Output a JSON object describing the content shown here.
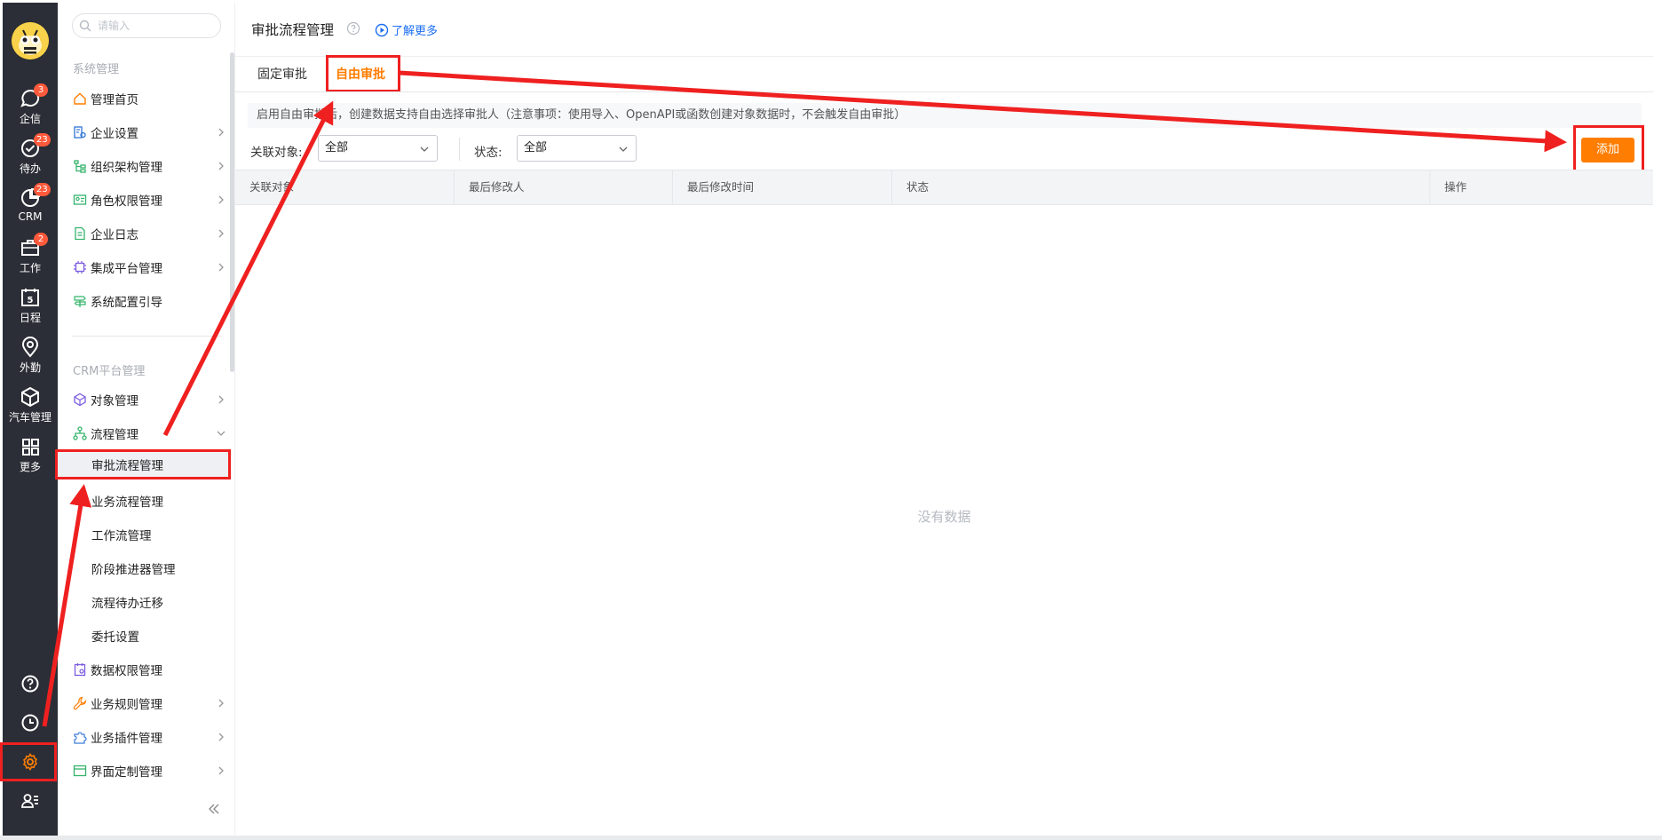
{
  "rail": {
    "items": [
      {
        "label": "企信",
        "icon": "chat-bubble-icon",
        "badge": "3"
      },
      {
        "label": "待办",
        "icon": "check-circle-icon",
        "badge": "23"
      },
      {
        "label": "CRM",
        "icon": "pie-chart-icon",
        "badge": "23"
      },
      {
        "label": "工作",
        "icon": "briefcase-icon",
        "badge": "2"
      },
      {
        "label": "日程",
        "icon": "calendar-icon",
        "badge": ""
      },
      {
        "label": "外勤",
        "icon": "location-pin-icon",
        "badge": ""
      },
      {
        "label": "汽车管理",
        "icon": "cube-icon",
        "badge": ""
      },
      {
        "label": "更多",
        "icon": "grid-icon",
        "badge": ""
      }
    ],
    "calendar_day": "5",
    "bottom_icons": [
      "help-circle-icon",
      "clock-icon",
      "gear-icon",
      "user-list-icon"
    ],
    "accent": "#ff7d00"
  },
  "sidebar": {
    "search_placeholder": "请输入",
    "section_system": "系统管理",
    "system_items": [
      {
        "label": "管理首页",
        "icon": "home-icon",
        "has_chevron": false
      },
      {
        "label": "企业设置",
        "icon": "building-settings-icon",
        "has_chevron": true
      },
      {
        "label": "组织架构管理",
        "icon": "org-tree-icon",
        "has_chevron": true
      },
      {
        "label": "角色权限管理",
        "icon": "id-card-icon",
        "has_chevron": true
      },
      {
        "label": "企业日志",
        "icon": "log-document-icon",
        "has_chevron": true
      },
      {
        "label": "集成平台管理",
        "icon": "chip-icon",
        "has_chevron": true
      },
      {
        "label": "系统配置引导",
        "icon": "signpost-icon",
        "has_chevron": false
      }
    ],
    "section_crm": "CRM平台管理",
    "crm_items": [
      {
        "label": "对象管理",
        "icon": "object-box-icon",
        "has_chevron": true
      },
      {
        "label": "流程管理",
        "icon": "flow-tree-icon",
        "expanded": true
      }
    ],
    "flow_sub_items": [
      {
        "label": "审批流程管理",
        "active": true
      },
      {
        "label": "业务流程管理"
      },
      {
        "label": "工作流管理"
      },
      {
        "label": "阶段推进器管理"
      },
      {
        "label": "流程待办迁移"
      },
      {
        "label": "委托设置"
      }
    ],
    "more_items": [
      {
        "label": "数据权限管理",
        "icon": "data-permission-icon",
        "has_chevron": false
      },
      {
        "label": "业务规则管理",
        "icon": "wrench-icon",
        "has_chevron": true
      },
      {
        "label": "业务插件管理",
        "icon": "puzzle-icon",
        "has_chevron": true
      },
      {
        "label": "界面定制管理",
        "icon": "layout-window-icon",
        "has_chevron": true
      }
    ]
  },
  "main": {
    "title": "审批流程管理",
    "learn_more": "了解更多",
    "tabs": [
      {
        "label": "固定审批",
        "active": false
      },
      {
        "label": "自由审批",
        "active": true
      }
    ],
    "notice": "启用自由审批后，创建数据支持自由选择审批人（注意事项：使用导入、OpenAPI或函数创建对象数据时，不会触发自由审批）",
    "filters": {
      "object_label": "关联对象:",
      "object_value": "全部",
      "status_label": "状态:",
      "status_value": "全部"
    },
    "add_button": "添加",
    "table_headers": [
      "关联对象",
      "最后修改人",
      "最后修改时间",
      "状态",
      "操作"
    ],
    "empty_text": "没有数据"
  }
}
